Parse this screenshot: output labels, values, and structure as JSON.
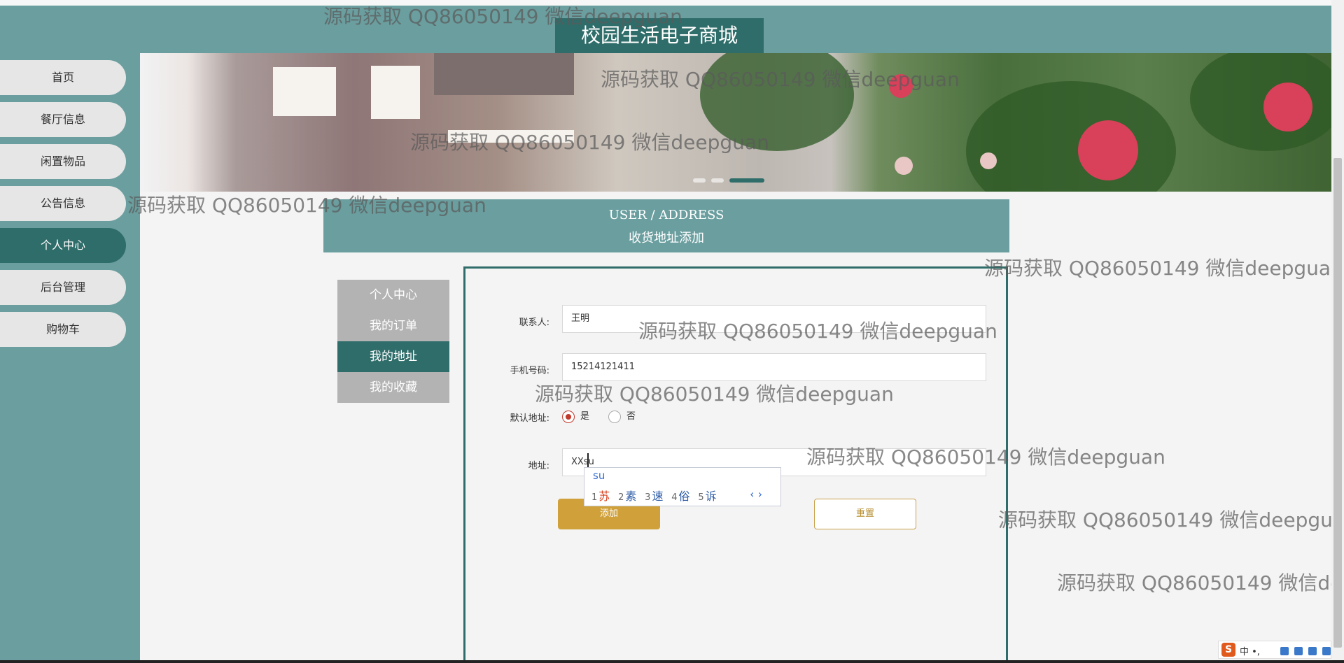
{
  "header": {
    "site_title": "校园生活电子商城"
  },
  "sidebar": {
    "items": [
      {
        "label": "首页"
      },
      {
        "label": "餐厅信息"
      },
      {
        "label": "闲置物品"
      },
      {
        "label": "公告信息"
      },
      {
        "label": "个人中心",
        "active": true
      },
      {
        "label": "后台管理"
      },
      {
        "label": "购物车"
      }
    ]
  },
  "section": {
    "en_title": "USER / ADDRESS",
    "cn_title": "收货地址添加"
  },
  "user_nav": {
    "items": [
      {
        "label": "个人中心"
      },
      {
        "label": "我的订单"
      },
      {
        "label": "我的地址",
        "active": true
      },
      {
        "label": "我的收藏"
      }
    ]
  },
  "form": {
    "contact_label": "联系人:",
    "contact_value": "王明",
    "phone_label": "手机号码:",
    "phone_value": "15214121411",
    "default_label": "默认地址:",
    "default_yes": "是",
    "default_no": "否",
    "default_selected": "是",
    "address_label": "地址:",
    "address_value": "XXsu",
    "add_button": "添加",
    "reset_button": "重置"
  },
  "ime_popup": {
    "pinyin": "su",
    "candidates": [
      {
        "n": "1",
        "c": "苏"
      },
      {
        "n": "2",
        "c": "素"
      },
      {
        "n": "3",
        "c": "速"
      },
      {
        "n": "4",
        "c": "俗"
      },
      {
        "n": "5",
        "c": "诉"
      }
    ],
    "pager": "‹ ›"
  },
  "watermark": "源码获取 QQ86050149 微信deepguan",
  "tray": {
    "logo": "S",
    "text": "中 •, "
  },
  "colors": {
    "primary": "#6b9e9f",
    "primary_dark": "#2f6d6a",
    "add_button": "#d0a13a",
    "nav_bg": "#e6e6e6",
    "sub_nav_bg": "#b3b3b3"
  }
}
